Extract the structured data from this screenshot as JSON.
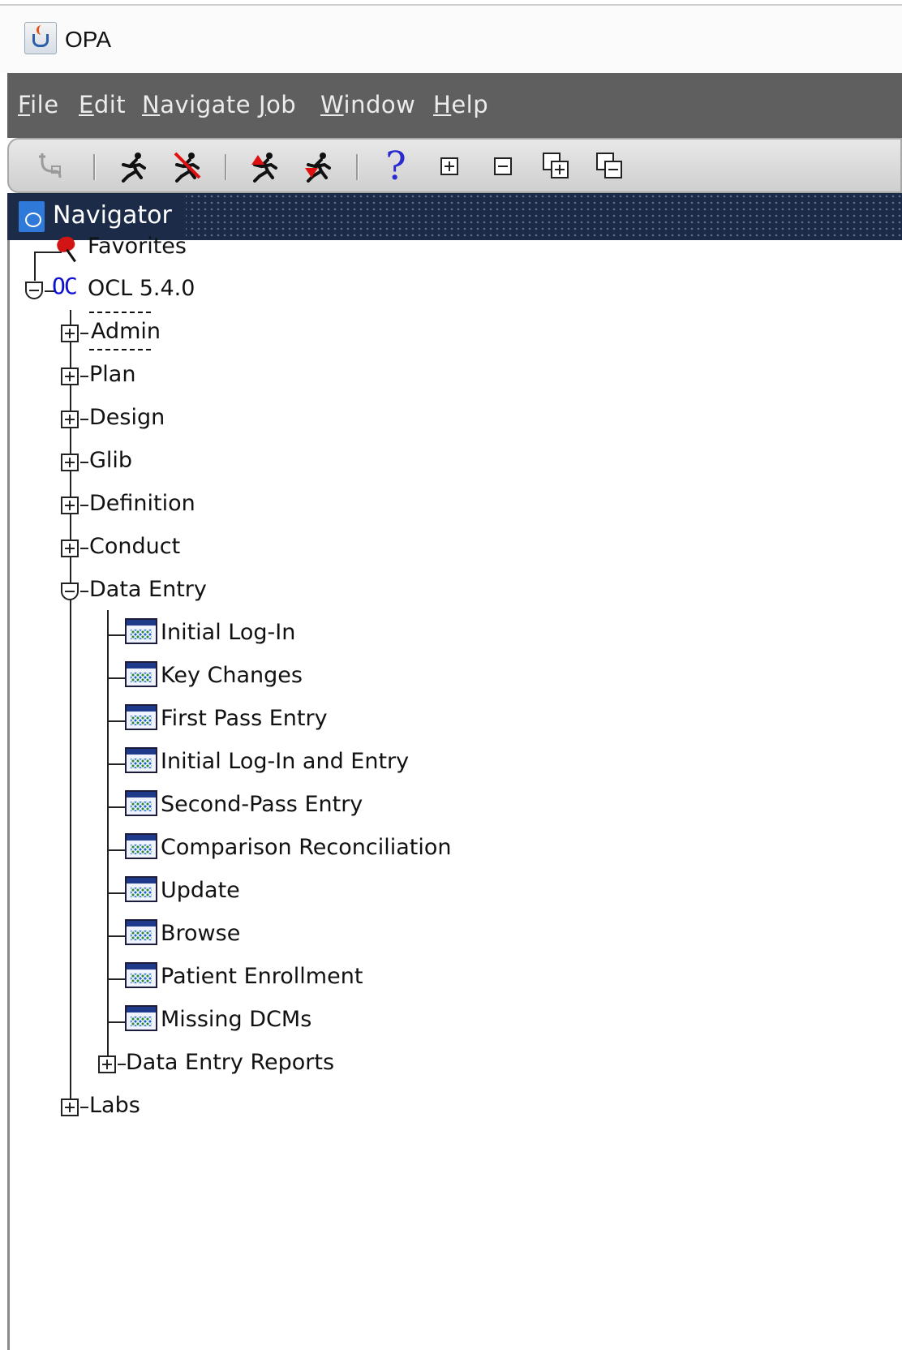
{
  "window": {
    "title": "OPA"
  },
  "menu": {
    "items": [
      {
        "label": "File",
        "mnemonic": "F"
      },
      {
        "label": "Edit",
        "mnemonic": "E"
      },
      {
        "label": "Navigate",
        "mnemonic": "N"
      },
      {
        "label": "Job",
        "mnemonic": "J"
      },
      {
        "label": "Window",
        "mnemonic": "W"
      },
      {
        "label": "Help",
        "mnemonic": "H"
      }
    ]
  },
  "toolbar": {
    "icons": [
      "connect-icon",
      "run-icon",
      "stop-run-icon",
      "run-up-icon",
      "run-down-icon",
      "help-icon",
      "expand-icon",
      "collapse-icon",
      "expand-all-icon",
      "collapse-all-icon"
    ]
  },
  "navigator": {
    "title": "Navigator"
  },
  "tree": {
    "favorites": "Favorites",
    "root": "OCL 5.4.0",
    "root_icon_text": "OC",
    "modules": [
      {
        "label": "Admin",
        "expanded": false
      },
      {
        "label": "Plan",
        "expanded": false
      },
      {
        "label": "Design",
        "expanded": false
      },
      {
        "label": "Glib",
        "expanded": false
      },
      {
        "label": "Definition",
        "expanded": false
      },
      {
        "label": "Conduct",
        "expanded": false
      },
      {
        "label": "Data Entry",
        "expanded": true
      },
      {
        "label": "Labs",
        "expanded": false
      }
    ],
    "data_entry_forms": [
      "Initial Log-In",
      "Key Changes",
      "First Pass Entry",
      "Initial Log-In and Entry",
      "Second-Pass Entry",
      "Comparison Reconciliation",
      "Update",
      "Browse",
      "Patient Enrollment",
      "Missing DCMs"
    ],
    "data_entry_reports": "Data Entry Reports"
  },
  "colors": {
    "menubar_bg": "#5f5f5f",
    "navigator_header_bg": "#1c2c48",
    "root_icon": "#1010d0",
    "favorites_pin": "#d21414"
  }
}
